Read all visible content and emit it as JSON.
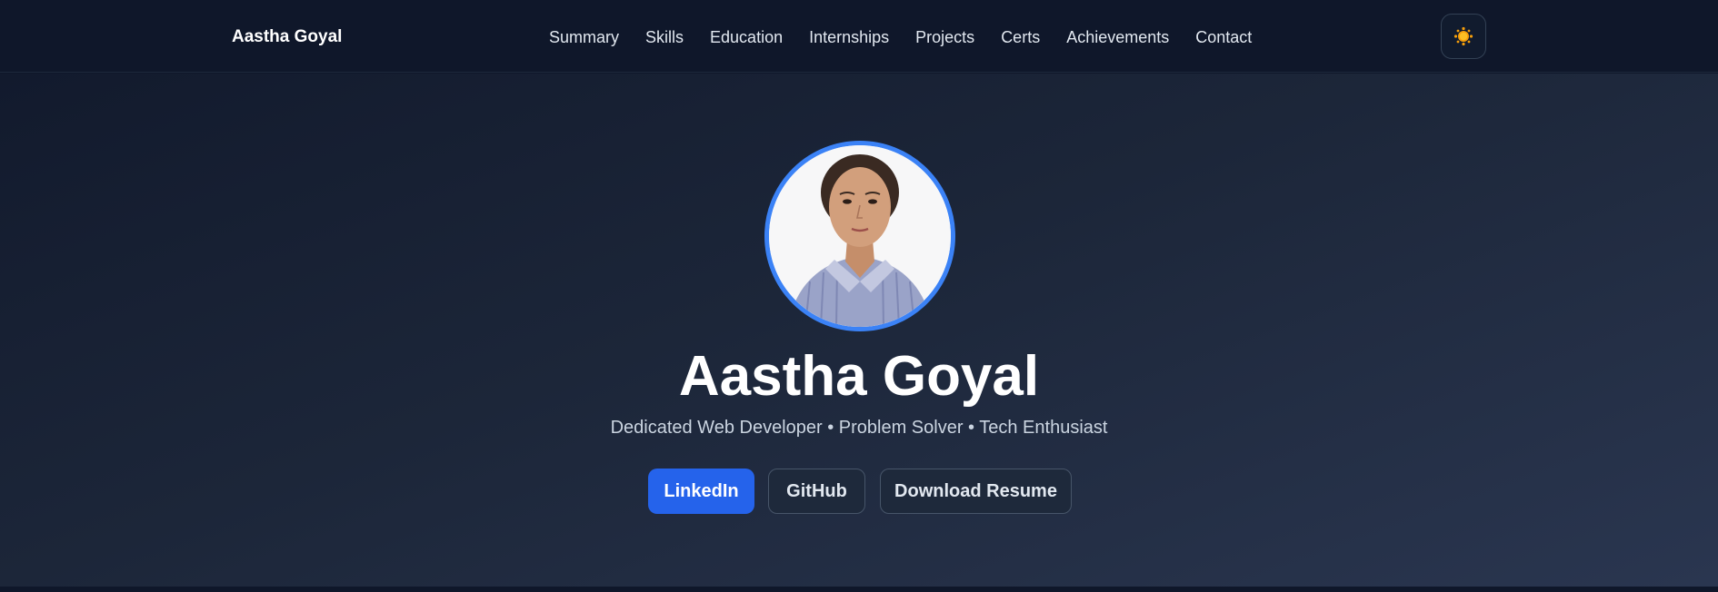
{
  "nav": {
    "brand": "Aastha Goyal",
    "links": [
      "Summary",
      "Skills",
      "Education",
      "Internships",
      "Projects",
      "Certs",
      "Achievements",
      "Contact"
    ],
    "theme_icon": "sun-icon"
  },
  "hero": {
    "avatar_alt": "Profile photo",
    "name": "Aastha Goyal",
    "tagline": "Dedicated Web Developer • Problem Solver • Tech Enthusiast",
    "buttons": {
      "linkedin": "LinkedIn",
      "github": "GitHub",
      "resume": "Download Resume"
    }
  },
  "colors": {
    "accent": "#2563eb",
    "avatar_ring": "#3b82f6",
    "nav_bg": "#0f172a",
    "sun": "#f59e0b"
  }
}
